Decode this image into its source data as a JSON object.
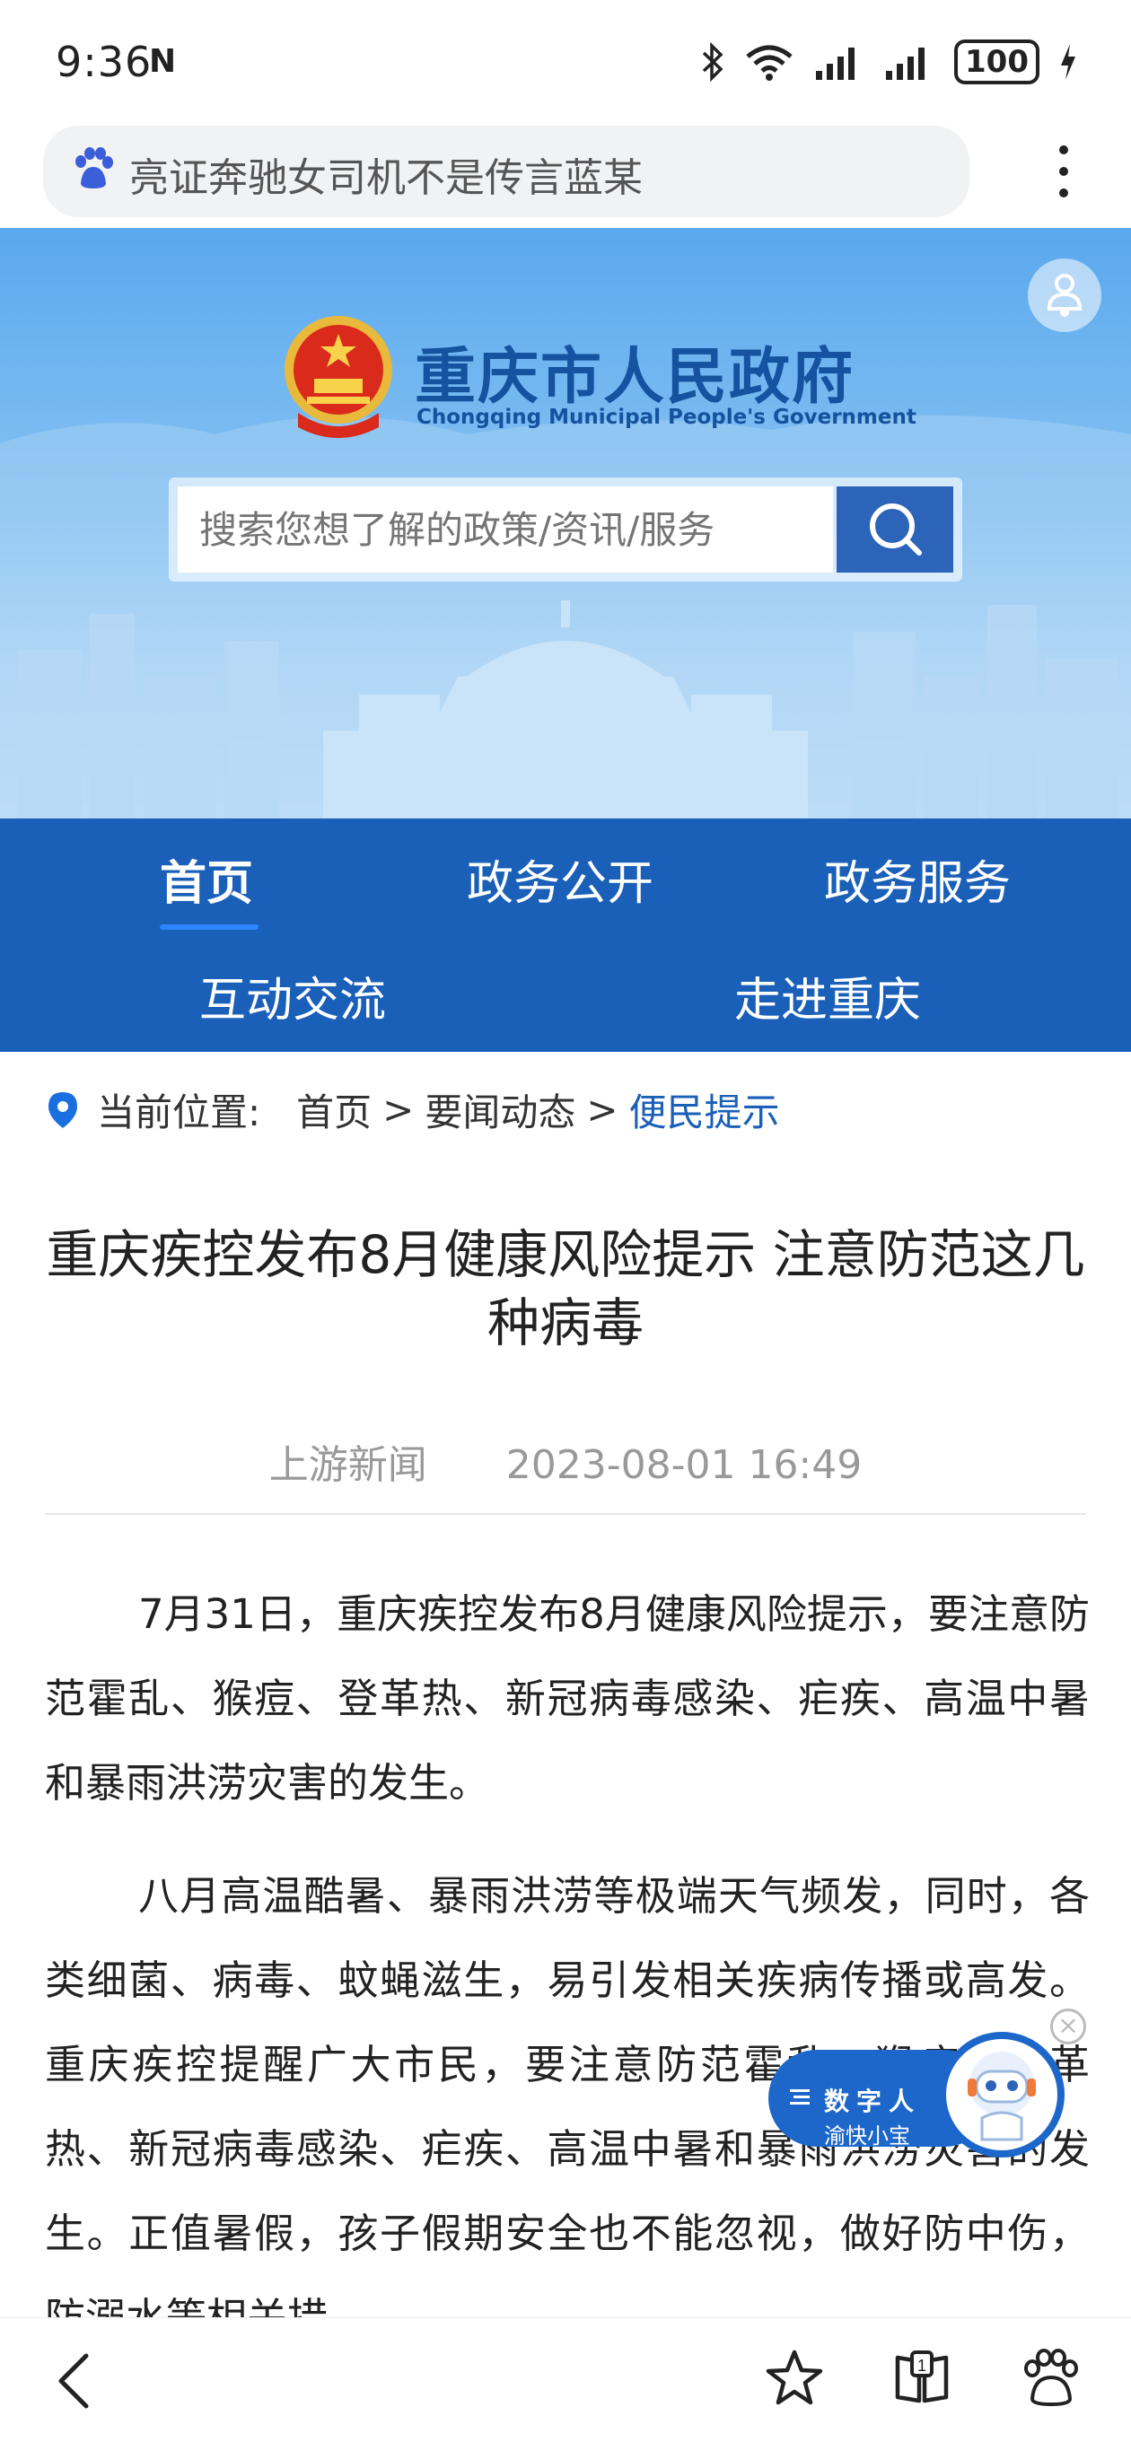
{
  "status_bar": {
    "time": "9:36",
    "nfc": "N",
    "battery": "100"
  },
  "browser": {
    "search_text": "亮证奔驰女司机不是传言蓝某"
  },
  "site": {
    "name_cn": "重庆市人民政府",
    "name_en": "Chongqing Municipal People's Government",
    "search_placeholder": "搜索您想了解的政策/资讯/服务"
  },
  "nav": {
    "items": [
      {
        "label": "首页"
      },
      {
        "label": "政务公开"
      },
      {
        "label": "政务服务"
      },
      {
        "label": "互动交流"
      },
      {
        "label": "走进重庆"
      }
    ]
  },
  "breadcrumb": {
    "prefix": "当前位置:",
    "items": [
      "首页",
      "要闻动态",
      "便民提示"
    ],
    "separator": ">"
  },
  "article": {
    "title": "重庆疾控发布8月健康风险提示 注意防范这几种病毒",
    "source": "上游新闻",
    "datetime": "2023-08-01 16:49",
    "paragraphs": [
      "7月31日，重庆疾控发布8月健康风险提示，要注意防范霍乱、猴痘、登革热、新冠病毒感染、疟疾、高温中暑和暴雨洪涝灾害的发生。",
      "八月高温酷暑、暴雨洪涝等极端天气频发，同时，各类细菌、病毒、蚊蝇滋生，易引发相关疾病传播或高发。重庆疾控提醒广大市民，要注意防范霍乱、猴痘、登革热、新冠病毒感染、疟疾、高温中暑和暴雨洪涝灾害的发生。正值暑假，孩子假期安全也不能忽视，做好防中伤，防溺水等相关措"
    ]
  },
  "assistant": {
    "line1": "数字人",
    "line2": "渝快小宝"
  },
  "colors": {
    "primary": "#1a5fb8",
    "accent": "#2d86ff"
  }
}
